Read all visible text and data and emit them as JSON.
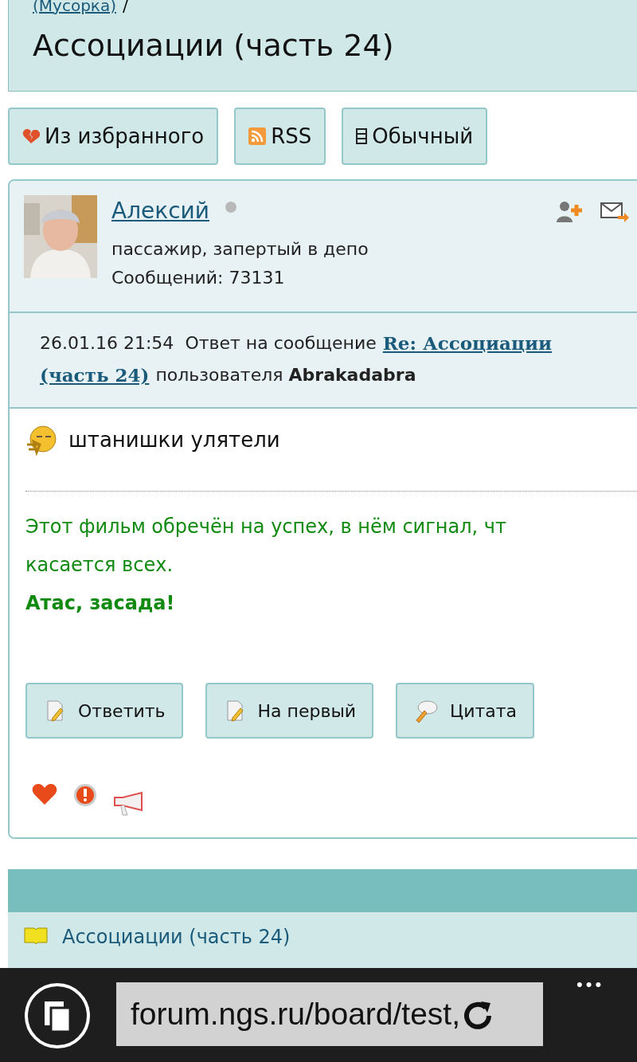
{
  "breadcrumb": {
    "link": "(Мусорка)",
    "separator": "/"
  },
  "title": "Ассоциации (часть 24)",
  "top_buttons": [
    {
      "kind": "unfavorite",
      "label": "Из избранного"
    },
    {
      "kind": "rss",
      "label": "RSS"
    },
    {
      "kind": "view",
      "label": "Обычный"
    }
  ],
  "post": {
    "author": "Алексий",
    "online": false,
    "status": "пассажир, запертый в депо",
    "messages": "Сообщений: 73131",
    "date": "26.01.16 21:54",
    "reply_prefix": "Ответ на сообщение",
    "reply_link_lines": [
      "Re: Ассоциации",
      "(часть 24)"
    ],
    "reply_user_prefix": "пользователя",
    "reply_user": "Abrakadabra",
    "text": "штанишки улятели",
    "quote_lines": [
      "Этот фильм обречён на успех, в нём сигнал, чт",
      "касается всех."
    ],
    "quote_bold": "Атас, засада!",
    "actions": [
      {
        "kind": "reply",
        "label": "Ответить"
      },
      {
        "kind": "reply",
        "label": "На первый"
      },
      {
        "kind": "quote",
        "label": "Цитата"
      }
    ]
  },
  "footer_link": "Ассоциации (часть 24)",
  "browser": {
    "url": "forum.ngs.ru/board/test,",
    "menu": "•••"
  }
}
